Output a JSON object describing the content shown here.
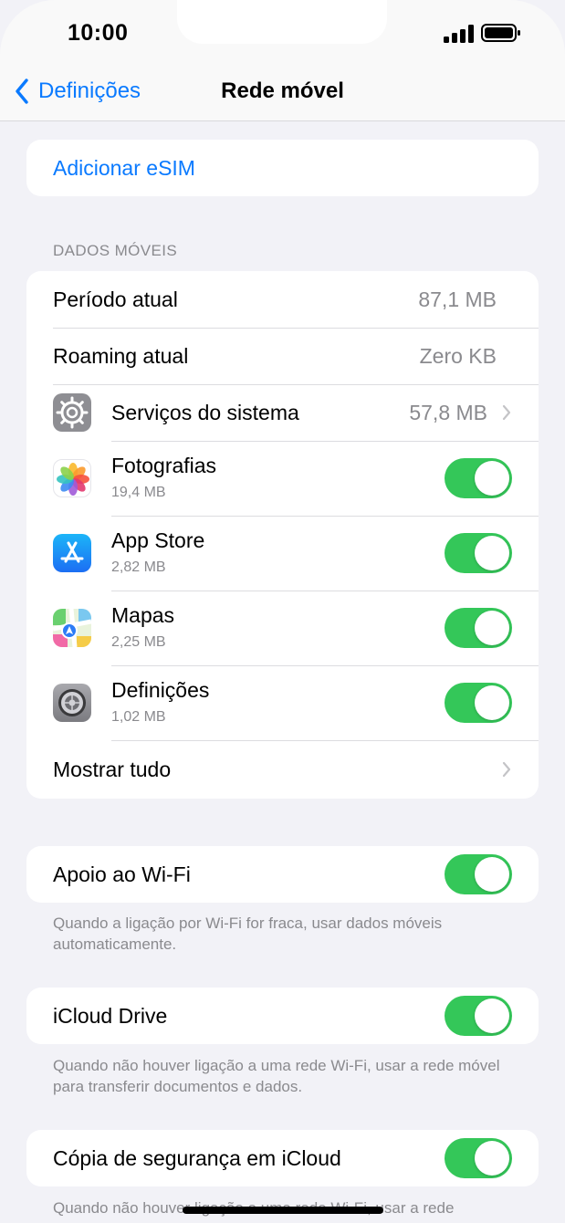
{
  "status_bar": {
    "time": "10:00"
  },
  "nav": {
    "back_label": "Definições",
    "title": "Rede móvel"
  },
  "esim": {
    "label": "Adicionar eSIM"
  },
  "mobile_data": {
    "header": "DADOS MÓVEIS",
    "current_period": {
      "label": "Período atual",
      "value": "87,1 MB"
    },
    "current_roaming": {
      "label": "Roaming atual",
      "value": "Zero KB"
    },
    "system_services": {
      "label": "Serviços do sistema",
      "value": "57,8 MB",
      "icon": "system-services-icon"
    },
    "apps": [
      {
        "name": "Fotografias",
        "size": "19,4 MB",
        "icon": "photos-icon",
        "enabled": true
      },
      {
        "name": "App Store",
        "size": "2,82 MB",
        "icon": "app-store-icon",
        "enabled": true
      },
      {
        "name": "Mapas",
        "size": "2,25 MB",
        "icon": "maps-icon",
        "enabled": true
      },
      {
        "name": "Definições",
        "size": "1,02 MB",
        "icon": "settings-icon",
        "enabled": true
      }
    ],
    "show_all": {
      "label": "Mostrar tudo"
    }
  },
  "wifi_assist": {
    "label": "Apoio ao Wi-Fi",
    "enabled": true,
    "footer": "Quando a ligação por Wi-Fi for fraca, usar dados móveis automaticamente."
  },
  "icloud_drive": {
    "label": "iCloud Drive",
    "enabled": true,
    "footer": "Quando não houver ligação a uma rede Wi-Fi, usar a rede móvel para transferir documentos e dados."
  },
  "icloud_backup": {
    "label": "Cópia de segurança em iCloud",
    "enabled": true,
    "footer": "Quando não houver ligação a uma rede Wi-Fi, usar a rede"
  },
  "colors": {
    "accent": "#0a7aff",
    "toggle_on": "#34c759",
    "background": "#f2f2f7",
    "secondary_text": "#8a8a8e"
  }
}
